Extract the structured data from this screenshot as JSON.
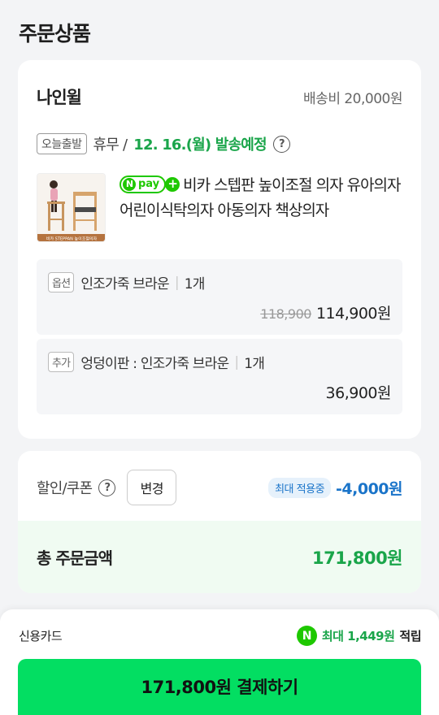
{
  "page": {
    "title": "주문상품"
  },
  "seller": {
    "name": "나인윌",
    "shipping_fee": "배송비 20,000원"
  },
  "shipping": {
    "tag": "오늘출발",
    "status": "휴무 /",
    "date": "12. 16.(월) 발송예정",
    "help_icon": "?"
  },
  "product": {
    "npay_label": "pay",
    "name": "비카 스텝판 높이조절 의자 유아의자 어린이식탁의자 아동의자 책상의자",
    "thumb_caption": "비카 STEPPAN 높이조절의자"
  },
  "options": [
    {
      "tag": "옵션",
      "name": "인조가죽 브라운",
      "qty": "1개",
      "original_price": "118,900",
      "price": "114,900원"
    },
    {
      "tag": "추가",
      "name": "엉덩이판 : 인조가죽 브라운",
      "qty": "1개",
      "original_price": "",
      "price": "36,900원"
    }
  ],
  "discount": {
    "label": "할인/쿠폰",
    "change_button": "변경",
    "max_badge": "최대 적용중",
    "amount": "-4,000원"
  },
  "total": {
    "label": "총 주문금액",
    "value": "171,800원"
  },
  "payment": {
    "method": "신용카드",
    "points_prefix": "최대 1,449원",
    "points_suffix": "적립",
    "pay_button": "171,800원 결제하기"
  },
  "colors": {
    "accent_green": "#03de62",
    "text_green": "#1aa54a",
    "blue": "#1a74c9",
    "npay_green": "#1ec800"
  }
}
